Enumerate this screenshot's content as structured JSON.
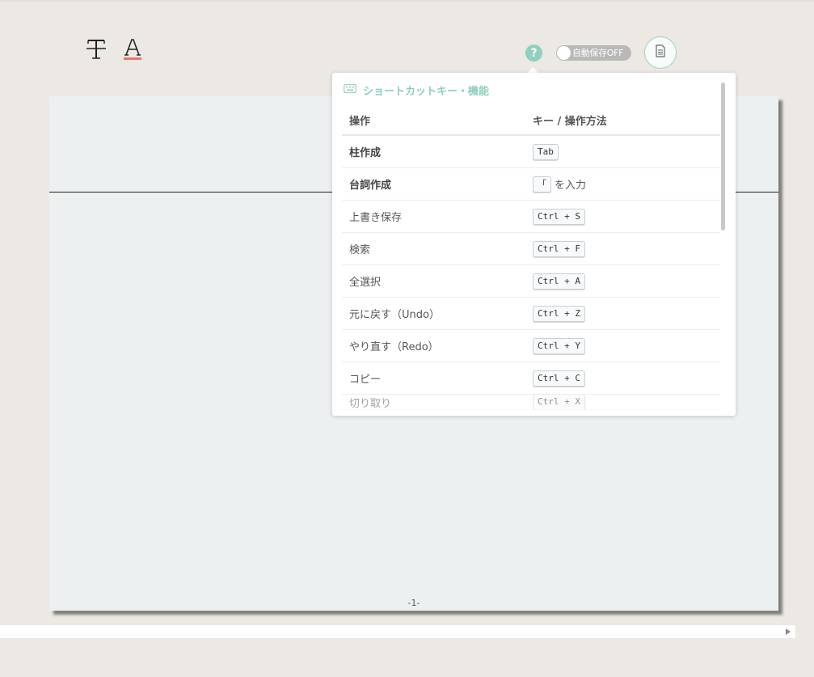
{
  "toolbar": {
    "strike_icon": "strikethrough-T-icon",
    "font_color_icon": "font-color-A-icon",
    "font_color_underline": "#e8756a",
    "help_label": "?",
    "autosave_label": "自動保存OFF",
    "document_icon": "document-icon"
  },
  "colors": {
    "accent": "#8fd0bf",
    "background": "#ece8e4",
    "paper": "#ecf0f1"
  },
  "paper": {
    "page_number": "-1-"
  },
  "shortcuts": {
    "title": "ショートカットキー・機能",
    "header_icon": "keyboard-icon",
    "columns": {
      "operation": "操作",
      "key": "キー / 操作方法"
    },
    "rows": [
      {
        "op": "柱作成",
        "key": "Tab",
        "after": ""
      },
      {
        "op": "台詞作成",
        "key": "「",
        "after": "を入力"
      },
      {
        "op": "上書き保存",
        "key": "Ctrl + S",
        "after": ""
      },
      {
        "op": "検索",
        "key": "Ctrl + F",
        "after": ""
      },
      {
        "op": "全選択",
        "key": "Ctrl + A",
        "after": ""
      },
      {
        "op": "元に戻す（Undo）",
        "key": "Ctrl + Z",
        "after": ""
      },
      {
        "op": "やり直す（Redo）",
        "key": "Ctrl + Y",
        "after": ""
      },
      {
        "op": "コピー",
        "key": "Ctrl + C",
        "after": ""
      },
      {
        "op": "切り取り",
        "key": "Ctrl + X",
        "after": ""
      }
    ]
  }
}
